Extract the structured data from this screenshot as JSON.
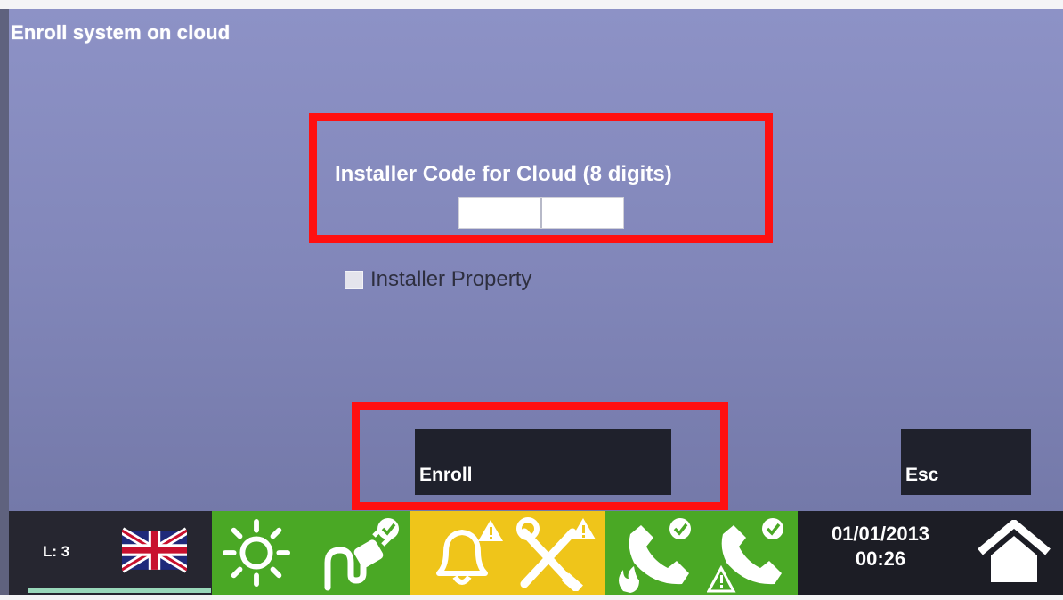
{
  "screen": {
    "title": "Enroll system on cloud",
    "installer_code": {
      "label": "Installer Code for Cloud (8 digits)",
      "value": ""
    },
    "installer_property": {
      "label": "Installer Property",
      "checked": false
    },
    "buttons": {
      "enroll": "Enroll",
      "esc": "Esc"
    }
  },
  "statusbar": {
    "level": "L: 3",
    "language_icon": "uk-flag-icon",
    "icons": [
      "sun-icon",
      "power-plug-check-icon",
      "bell-warning-icon",
      "tools-warning-icon",
      "phone-fire-check-icon",
      "phone-warning-check-icon",
      "home-icon"
    ],
    "date": "01/01/2013",
    "time": "00:26"
  },
  "colors": {
    "screen_bg": "#8287ba",
    "highlight": "#ff1010",
    "green": "#4aa825",
    "yellow": "#efc51a",
    "button_bg": "#1f212c"
  }
}
